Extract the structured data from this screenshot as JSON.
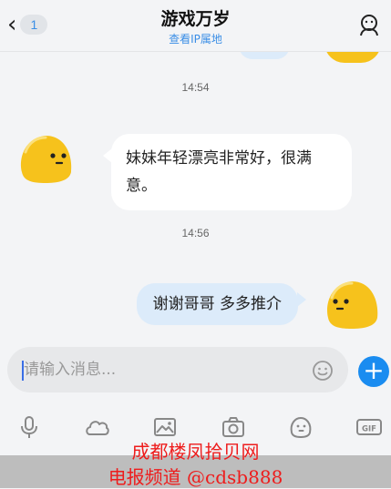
{
  "header": {
    "back_badge": "1",
    "title": "游戏万岁",
    "subtitle": "查看IP属地"
  },
  "icons": {
    "back": "chevron-left-icon",
    "profile": "person-outline-icon",
    "emoji": "smile-icon",
    "plus": "plus-icon",
    "voice": "microphone-icon",
    "cloud": "cloud-icon",
    "image": "image-icon",
    "camera": "camera-icon",
    "sticker": "emoji-face-icon",
    "gif": "gif-icon"
  },
  "messages": [
    {
      "time": "14:54"
    },
    {
      "side": "left",
      "text": "妹妹年轻漂亮非常好，很满意。"
    },
    {
      "time": "14:56"
    },
    {
      "side": "right",
      "text": "谢谢哥哥  多多推介"
    }
  ],
  "input": {
    "placeholder": "请输入消息..."
  },
  "colors": {
    "accent": "#1a8cf0",
    "bubble_self": "#dcebfa",
    "avatar_yellow": "#f6c21c",
    "watermark_red": "#ee1c1c"
  },
  "watermark": {
    "line1": "成都楼凤拾贝网",
    "line2": "电报频道 @cdsb888"
  }
}
